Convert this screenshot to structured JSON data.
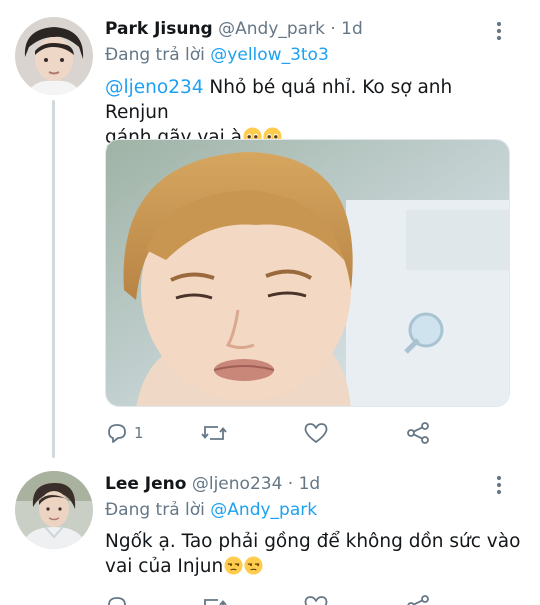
{
  "tweets": [
    {
      "name": "Park Jisung",
      "handle": "@Andy_park",
      "separator": "·",
      "time": "1d",
      "reply_prefix": "Đang trả lời",
      "reply_to": "@yellow_3to3",
      "mention": "@ljeno234",
      "body": " Nhỏ bé quá nhỉ. Ko sợ anh Renjun",
      "body_line2": "gánh gãy vai à",
      "emojis": [
        "pleading-face",
        "pleading-face"
      ],
      "actions": {
        "reply_count": "1",
        "retweet_count": "",
        "like_count": ""
      }
    },
    {
      "name": "Lee Jeno",
      "handle": "@ljeno234",
      "separator": "·",
      "time": "1d",
      "reply_prefix": "Đang trả lời",
      "reply_to": "@Andy_park",
      "body": "Ngốk ạ. Tao phải gồng để không dồn sức vào",
      "body_line2": "vai của Injun",
      "emojis": [
        "unamused-face",
        "unamused-face"
      ]
    }
  ],
  "icons": {
    "more": "more-vertical-icon",
    "reply": "reply-icon",
    "retweet": "retweet-icon",
    "like": "heart-icon",
    "share": "share-icon"
  },
  "colors": {
    "accent": "#1da1f2",
    "muted": "#657786",
    "text": "#14171a"
  }
}
